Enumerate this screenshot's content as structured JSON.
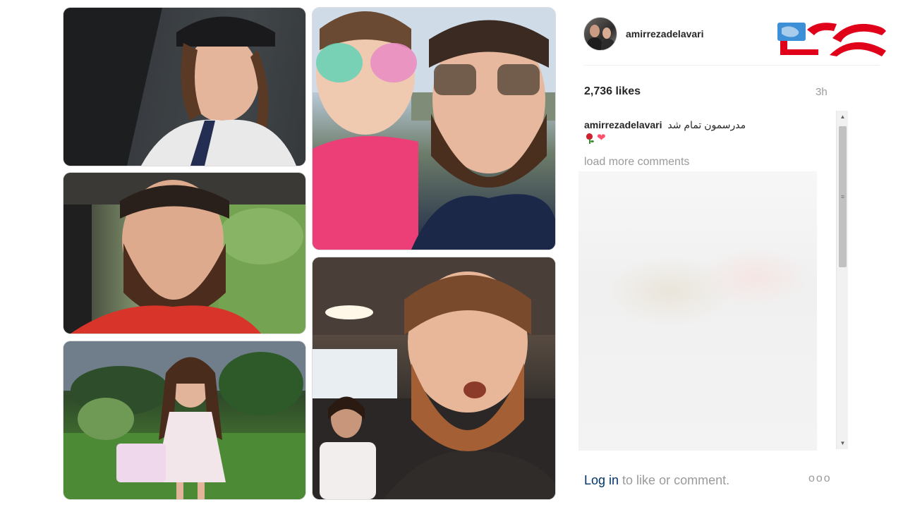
{
  "post": {
    "username": "amirrezadelavari",
    "likes": "2,736 likes",
    "time": "3h",
    "caption_user": "amirrezadelavari",
    "caption_text": "مدرسمون تمام شد",
    "load_more": "load more comments",
    "footer_login": "Log in",
    "footer_rest": " to like or comment.",
    "more_options": "ooo"
  },
  "icons": {
    "avatar": "profile-avatar",
    "emoji": [
      "rose-emoji",
      "heart-emoji"
    ],
    "more": "more-options-icon",
    "scroll_up": "scroll-up-arrow",
    "scroll_down": "scroll-down-arrow"
  },
  "colors": {
    "link": "#003569",
    "muted": "#9a9a9a",
    "logo_red": "#e1001a",
    "logo_blue": "#3d8fd6"
  }
}
